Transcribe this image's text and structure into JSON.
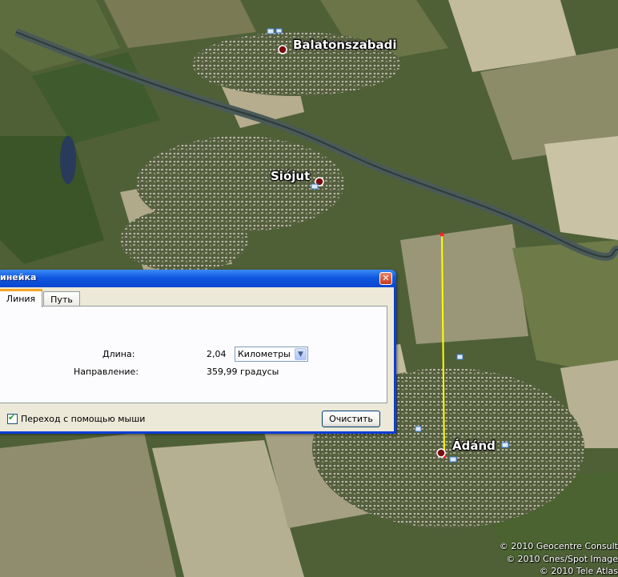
{
  "map": {
    "places": [
      {
        "name": "Balatonszabadi"
      },
      {
        "name": "Siójut"
      },
      {
        "name": "Ádánd"
      }
    ],
    "copyright": [
      "© 2010 Geocentre Consult",
      "© 2010 Cnes/Spot Image",
      "© 2010 Tele Atlas"
    ],
    "colors": {
      "measure_line": "#ffff00",
      "canal": "#4a5a58",
      "field_dark": "#3f5a2c",
      "field_light": "#a8a48a"
    }
  },
  "dialog": {
    "title": "инейка",
    "close_glyph": "✕",
    "tabs": [
      {
        "label": "Линия",
        "active": true
      },
      {
        "label": "Путь",
        "active": false
      }
    ],
    "length_label": "Длина:",
    "length_value": "2,04",
    "unit_selected": "Километры",
    "direction_label": "Направление:",
    "direction_value": "359,99 градусы",
    "mouse_nav_label": "Переход с помощью мыши",
    "mouse_nav_checked": true,
    "clear_button": "Очистить"
  }
}
